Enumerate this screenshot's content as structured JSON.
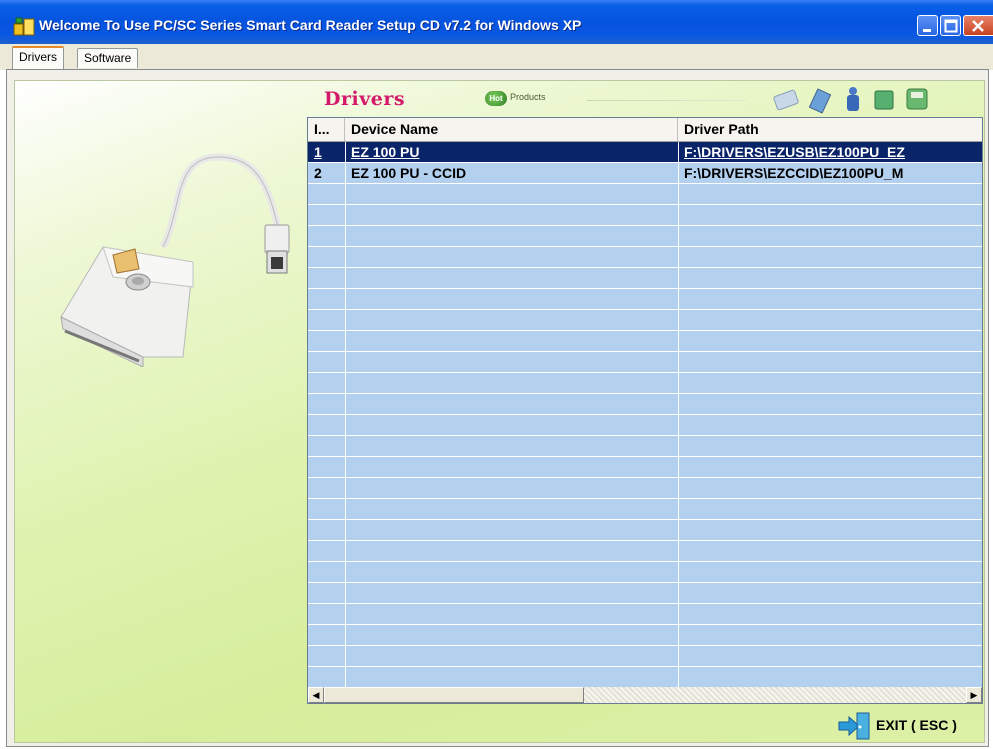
{
  "window": {
    "title": "Welcome To Use PC/SC Series Smart Card Reader Setup CD v7.2 for Windows XP"
  },
  "tabs": [
    {
      "label": "Drivers",
      "active": true
    },
    {
      "label": "Software",
      "active": false
    }
  ],
  "panel": {
    "heading": "Drivers",
    "hot_badge": "Hot",
    "products_label": "Products"
  },
  "table": {
    "columns": [
      "I...",
      "Device Name",
      "Driver Path"
    ],
    "rows": [
      {
        "index": "1",
        "device_name": "EZ 100 PU",
        "driver_path": "F:\\DRIVERS\\EZUSB\\EZ100PU_EZ",
        "selected": true
      },
      {
        "index": "2",
        "device_name": "EZ 100 PU - CCID",
        "driver_path": "F:\\DRIVERS\\EZCCID\\EZ100PU_M",
        "selected": false
      }
    ]
  },
  "exit_button": {
    "label": "EXIT ( ESC )"
  },
  "colors": {
    "heading": "#d4196b",
    "selection": "#0a246a",
    "list_background": "#b3d1ef",
    "titlebar": "#0553de"
  },
  "icons": [
    "app-icon",
    "minimize-icon",
    "maximize-icon",
    "close-icon",
    "smart-card-reader-illustration",
    "hot-products-icon",
    "toolbar-icons",
    "exit-door-icon",
    "scroll-left-arrow-icon",
    "scroll-right-arrow-icon"
  ]
}
